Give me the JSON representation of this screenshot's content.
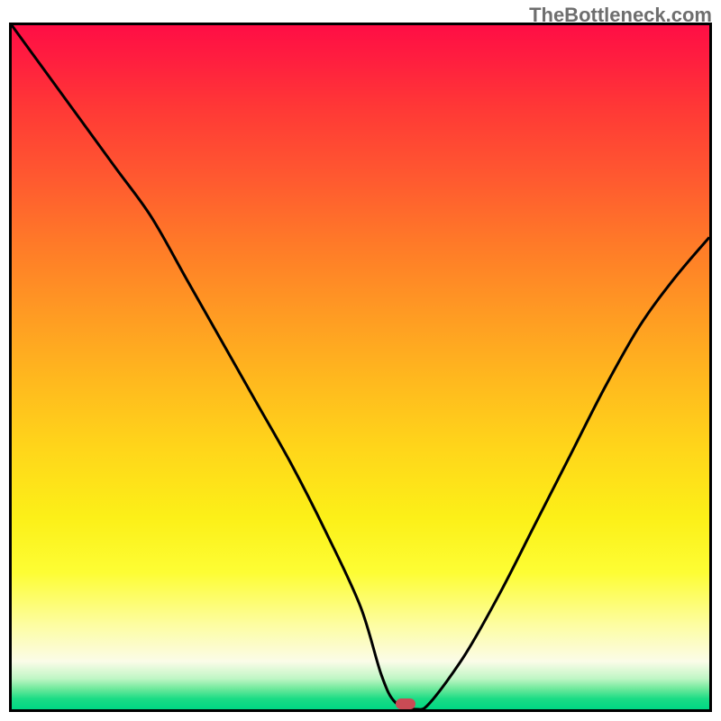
{
  "watermark": "TheBottleneck.com",
  "chart_data": {
    "type": "line",
    "title": "",
    "xlabel": "",
    "ylabel": "",
    "xlim": [
      0,
      100
    ],
    "ylim": [
      0,
      100
    ],
    "grid": false,
    "legend": false,
    "series": [
      {
        "name": "bottleneck-curve",
        "x": [
          0,
          5,
          10,
          15,
          20,
          25,
          30,
          35,
          40,
          45,
          50,
          53,
          55,
          58,
          60,
          65,
          70,
          75,
          80,
          85,
          90,
          95,
          100
        ],
        "y": [
          100,
          93,
          86,
          79,
          72,
          63,
          54,
          45,
          36,
          26,
          15,
          5,
          1,
          0,
          1,
          8,
          17,
          27,
          37,
          47,
          56,
          63,
          69
        ]
      }
    ],
    "marker": {
      "x": 56.5,
      "y": 0.8
    }
  },
  "colors": {
    "curve": "#000000",
    "border": "#000000",
    "marker": "#c94b55"
  }
}
